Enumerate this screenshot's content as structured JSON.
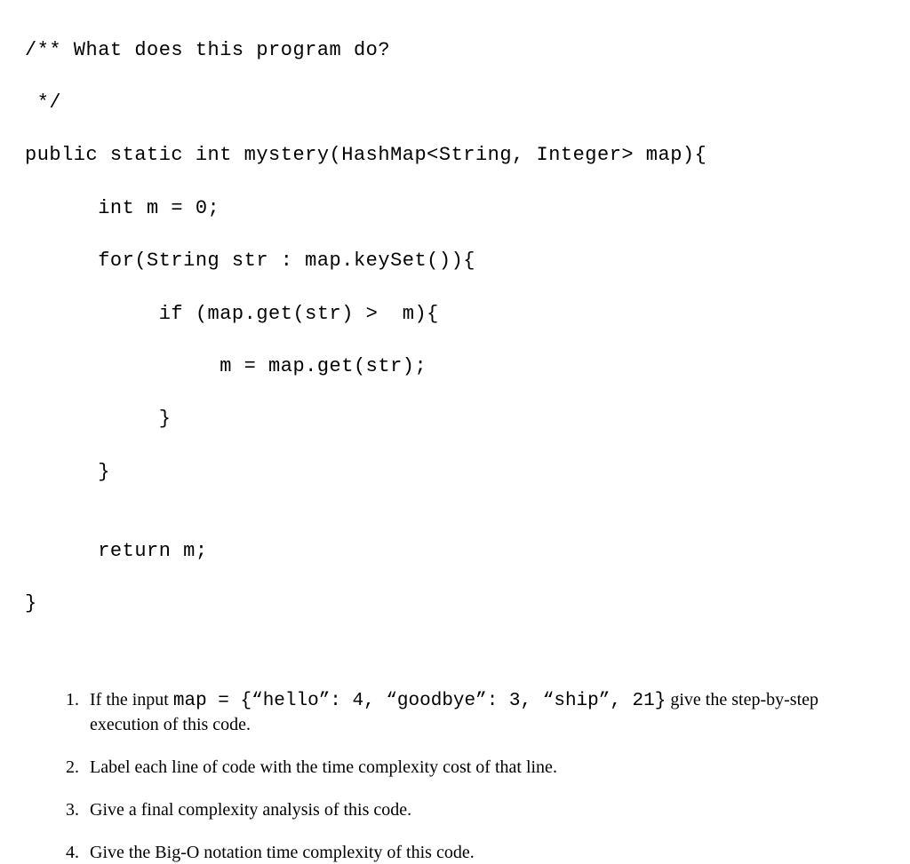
{
  "code": {
    "line1": "/** What does this program do?",
    "line2": " */",
    "line3": "public static int mystery(HashMap<String, Integer> map){",
    "line4": "      int m = 0;",
    "line5": "      for(String str : map.keySet()){",
    "line6": "           if (map.get(str) >  m){",
    "line7": "                m = map.get(str);",
    "line8": "           }",
    "line9": "      }",
    "line10": "",
    "line11": "      return m;",
    "line12": "}"
  },
  "questions": {
    "q1": {
      "num": "1.",
      "pre": "If the input ",
      "mono": "map = {“hello”: 4, “goodbye”: 3, “ship”, 21}",
      "post": " give the step-by-step execution of this code."
    },
    "q2": {
      "num": "2.",
      "text": "Label each line of code with the time complexity cost of that line."
    },
    "q3": {
      "num": "3.",
      "text": "Give a final complexity analysis of this code."
    },
    "q4": {
      "num": "4.",
      "text": "Give the Big-O notation time complexity of this code."
    }
  }
}
